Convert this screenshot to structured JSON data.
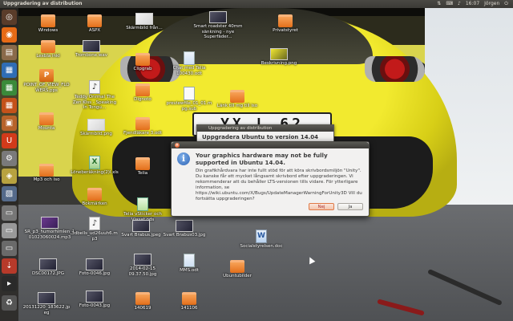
{
  "top_panel": {
    "title": "Uppgradering av distribution",
    "time": "16:07",
    "user": "Jörgen",
    "tray_icons": [
      "network-icon",
      "sound-icon",
      "keyboard-icon"
    ]
  },
  "launcher": {
    "items": [
      "dash-icon",
      "firefox-icon",
      "files-icon",
      "writer-icon",
      "calc-icon",
      "impress-icon",
      "software-center-icon",
      "ubuntu-one-icon",
      "settings-icon",
      "workspace-icon",
      "image-viewer-icon",
      "disk-icon",
      "usb-icon",
      "terminal-icon",
      "trash-icon"
    ]
  },
  "desktop": {
    "icons": [
      {
        "label": "Windows",
        "type": "folder"
      },
      {
        "label": "ASPX",
        "type": "folder"
      },
      {
        "label": "Skärmbild från...",
        "type": "img-light"
      },
      {
        "label": "Smart roadster 40mm sänkning - nye Superfäder...",
        "type": "img"
      },
      {
        "label": "Privatstyret",
        "type": "folder"
      },
      {
        "label": "Lexbla inkl",
        "type": "folder"
      },
      {
        "label": "Trombone.wav",
        "type": "music"
      },
      {
        "label": "Clipgrab",
        "type": "folder"
      },
      {
        "label": "Chat med Telia 100430.odt",
        "type": "doc"
      },
      {
        "label": "Beskrivning.png",
        "type": "img-yellow"
      },
      {
        "label": "POINT_OF_VIEW_FLOWERS.pps",
        "type": "ppt"
      },
      {
        "label": "Teddy Onrmal The Zen Kiss - Speaking in Tongu...",
        "type": "music"
      },
      {
        "label": "Dignoto",
        "type": "folder"
      },
      {
        "label": "previewfile_01_01.mpg.sub",
        "type": "doc"
      },
      {
        "label": "Länk till mg till iso",
        "type": "folder"
      },
      {
        "label": "Mounta",
        "type": "folder"
      },
      {
        "label": "Skärmbild.png",
        "type": "img-light"
      },
      {
        "label": "Fjendläkare 3.odt",
        "type": "doc"
      },
      {
        "label": "Löneberäkning(2)l.xls",
        "type": "xls"
      },
      {
        "label": "Telia",
        "type": "folder"
      },
      {
        "label": "Mp3 och iso",
        "type": "folder"
      },
      {
        "label": "Bokmärken",
        "type": "folder"
      },
      {
        "label": "Telia vSticker och Viasat.ods",
        "type": "sheet"
      },
      {
        "label": "SR_p3_humorhimlen_101023060024.mp3",
        "type": "img-purple"
      },
      {
        "label": "3dbells_ud26uuh6.mp3",
        "type": "music"
      },
      {
        "label": "Svart Brabus.jpeg",
        "type": "img"
      },
      {
        "label": "Svart Brabus03.jpg",
        "type": "img"
      },
      {
        "label": "Socialstyrelsen.doc",
        "type": "word"
      },
      {
        "label": "DSC00172.JPG",
        "type": "img"
      },
      {
        "label": "Foto-0046.jpg",
        "type": "img"
      },
      {
        "label": "2014-02-15 09.37.50.jpg",
        "type": "img"
      },
      {
        "label": "MMS.odt",
        "type": "doc"
      },
      {
        "label": "Ubuntubilder",
        "type": "folder"
      },
      {
        "label": "20131220_183622.jpeg",
        "type": "img"
      },
      {
        "label": "Foto-0043.jpg",
        "type": "img"
      },
      {
        "label": "140619",
        "type": "folder"
      },
      {
        "label": "141106",
        "type": "folder"
      }
    ]
  },
  "wallpaper": {
    "plate_text": "YX L 62"
  },
  "behind_window": {
    "title": "Uppgradering av distribution",
    "body": "Uppgradera Ubuntu to version 14.04"
  },
  "dialog": {
    "heading": "Your graphics hardware may not be fully supported in Ubuntu 14.04.",
    "message": "Din grafikhårdvara har inte fullt stöd för att köra skrivbordsmiljön \"Unity\". Du kanske får ett mycket långsamt skrivbord efter uppgraderingen. Vi rekommenderar att du behåller LTS-versionen tills vidare. För ytterligare information, se https://wiki.ubuntu.com/X/Bugs/UpdateManagerWarningForUnity3D Vill du fortsätta uppgraderingen?",
    "no_label": "Nej",
    "yes_label": "Ja",
    "info_glyph": "i",
    "close_glyph": "×"
  }
}
